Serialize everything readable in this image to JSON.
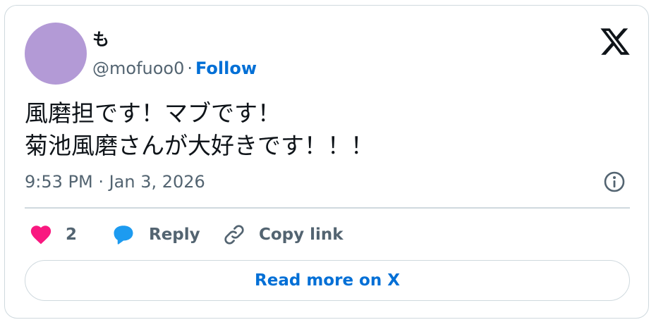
{
  "author": {
    "display_name": "も",
    "handle": "@mofuoo0",
    "separator": "·",
    "follow_label": "Follow",
    "avatar_color": "#b39ad6"
  },
  "brand": {
    "logo_icon": "x-logo-icon"
  },
  "tweet": {
    "lines": [
      "風磨担です！マブです！",
      "菊池風磨さんが大好きです！！！"
    ],
    "timestamp": "9:53 PM · Jan 3, 2026",
    "info_icon": "info-icon"
  },
  "actions": {
    "like": {
      "icon": "heart-icon",
      "count": "2",
      "color": "#f91880"
    },
    "reply": {
      "icon": "speech-bubble-icon",
      "label": "Reply",
      "color": "#1d9bf0"
    },
    "copy_link": {
      "icon": "link-icon",
      "label": "Copy link"
    }
  },
  "read_more": {
    "label": "Read more on X"
  },
  "colors": {
    "accent": "#006fd6",
    "secondary_text": "#536471",
    "border": "#cfd9de"
  }
}
